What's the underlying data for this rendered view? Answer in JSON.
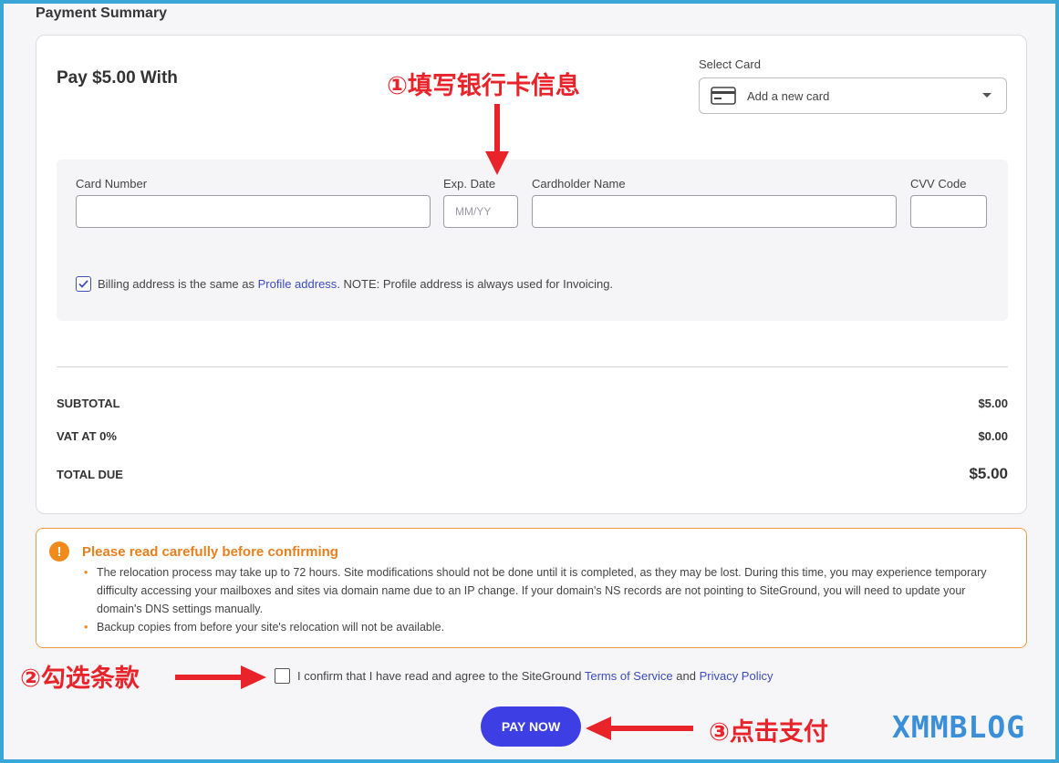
{
  "section_title": "Payment Summary",
  "pay_with": "Pay $5.00 With",
  "select_card": {
    "label": "Select Card",
    "value": "Add a new card"
  },
  "card_form": {
    "card_number_label": "Card Number",
    "exp_date_label": "Exp. Date",
    "exp_date_placeholder": "MM/YY",
    "cardholder_label": "Cardholder Name",
    "cvv_label": "CVV Code"
  },
  "billing": {
    "text_before": "Billing address is the same as ",
    "link": "Profile address",
    "text_after": ". NOTE: Profile address is always used for Invoicing."
  },
  "totals": {
    "subtotal_label": "SUBTOTAL",
    "subtotal_value": "$5.00",
    "vat_label": "VAT AT 0%",
    "vat_value": "$0.00",
    "total_label": "TOTAL DUE",
    "total_value": "$5.00"
  },
  "warning": {
    "title": "Please read carefully before confirming",
    "items": [
      "The relocation process may take up to 72 hours. Site modifications should not be done until it is completed, as they may be lost. During this time, you may experience temporary difficulty accessing your mailboxes and sites via domain name due to an IP change. If your domain's NS records are not pointing to SiteGround, you will need to update your domain's DNS settings manually.",
      "Backup copies from before your site's relocation will not be available."
    ]
  },
  "confirm": {
    "text_before": "I confirm that I have read and agree to the SiteGround ",
    "tos_link": "Terms of Service",
    "and": " and ",
    "privacy_link": "Privacy Policy"
  },
  "pay_button": "PAY NOW",
  "annotations": {
    "step1": "①填写银行卡信息",
    "step2": "②勾选条款",
    "step3": "③点击支付"
  },
  "watermark": "XMMBLOG",
  "logo": "XMMBLOG",
  "colors": {
    "accent": "#3d3ee3",
    "link": "#3b4cc0",
    "warning": "#f08a1c",
    "annotation": "#e8232a",
    "frame": "#3aa6d8"
  }
}
